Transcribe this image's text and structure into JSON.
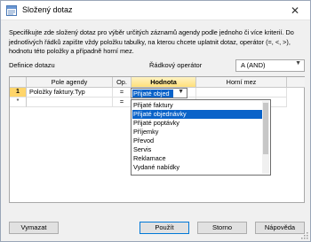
{
  "window": {
    "title": "Složený dotaz",
    "close_glyph": "✕"
  },
  "description": "Specifikujte zde složený dotaz pro výběr určitých záznamů agendy podle jednoho či více kriterií. Do jednotlivých řádků zapište vždy položku tabulky, na kterou chcete uplatnit dotaz, operátor (=, <, >), hodnotu této položky a případně horní mez.",
  "definition_label": "Definice dotazu",
  "operator": {
    "label": "Řádkový operátor",
    "value": "A (AND)"
  },
  "grid": {
    "columns": [
      "Pole agendy",
      "Op.",
      "Hodnota",
      "Horní mez"
    ],
    "rows": [
      {
        "num": "1",
        "field": "Položky faktury.Typ",
        "op": "=",
        "value": "Přijaté objed",
        "upper": ""
      },
      {
        "num": "*",
        "field": "",
        "op": "=",
        "value": "",
        "upper": ""
      }
    ]
  },
  "dropdown": {
    "items": [
      "Přijaté faktury",
      "Přijaté objednávky",
      "Přijaté poptávky",
      "Příjemky",
      "Převod",
      "Servis",
      "Reklamace",
      "Vydané nabídky"
    ],
    "selected_index": 1
  },
  "buttons": {
    "clear": "Vymazat",
    "use": "Použít",
    "cancel": "Storno",
    "help": "Nápověda"
  },
  "colors": {
    "selection": "#0a63c9",
    "active_header": "#ffdf7a",
    "default_button_border": "#0078d7"
  },
  "icons": {
    "app": "query-icon",
    "close": "close-icon",
    "chevron": "chevron-down-icon",
    "grip": "resize-grip-icon"
  }
}
